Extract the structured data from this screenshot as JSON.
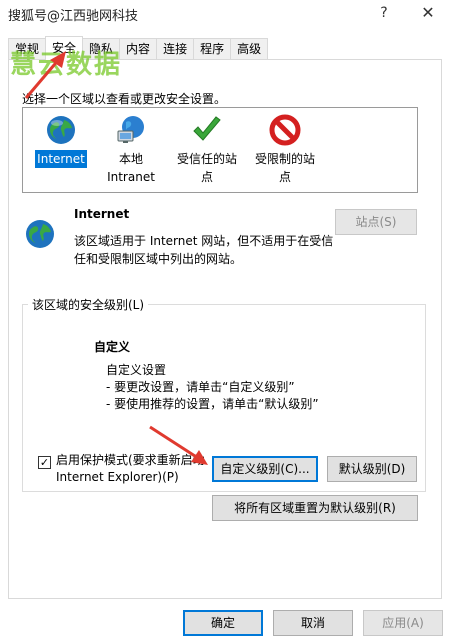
{
  "window": {
    "title": "搜狐号@江西驰网科技",
    "help_label": "?",
    "close_label": "✕"
  },
  "watermark": "慧云数据",
  "tabs": [
    {
      "label": "常规"
    },
    {
      "label": "安全"
    },
    {
      "label": "隐私"
    },
    {
      "label": "内容"
    },
    {
      "label": "连接"
    },
    {
      "label": "程序"
    },
    {
      "label": "高级"
    }
  ],
  "instruction": "选择一个区域以查看或更改安全设置。",
  "zones": [
    {
      "line1": "Internet",
      "line2": "",
      "icon": "globe-icon"
    },
    {
      "line1": "本地",
      "line2": "Intranet",
      "icon": "local-intranet-icon"
    },
    {
      "line1": "受信任的站",
      "line2": "点",
      "icon": "checkmark-icon"
    },
    {
      "line1": "受限制的站",
      "line2": "点",
      "icon": "restricted-icon"
    }
  ],
  "info": {
    "title": "Internet",
    "desc": "该区域适用于 Internet 网站，但不适用于在受信任和受限制区域中列出的网站。",
    "sites_button": "站点(S)"
  },
  "level_group": {
    "legend": "该区域的安全级别(L)",
    "title": "自定义",
    "lines": [
      "自定义设置",
      "- 要更改设置，请单击“自定义级别”",
      "- 要使用推荐的设置，请单击“默认级别”"
    ]
  },
  "protect_mode": {
    "checked": true,
    "check_mark": "✓",
    "label_line1": "启用保护模式(要求重新启动",
    "label_line2": "Internet Explorer)(P)"
  },
  "buttons": {
    "custom_level": "自定义级别(C)...",
    "default_level": "默认级别(D)",
    "reset_all": "将所有区域重置为默认级别(R)",
    "ok": "确定",
    "cancel": "取消",
    "apply": "应用(A)"
  },
  "colors": {
    "selection": "#0078d7",
    "arrow": "#e03a2f",
    "watermark": "#78c828"
  }
}
